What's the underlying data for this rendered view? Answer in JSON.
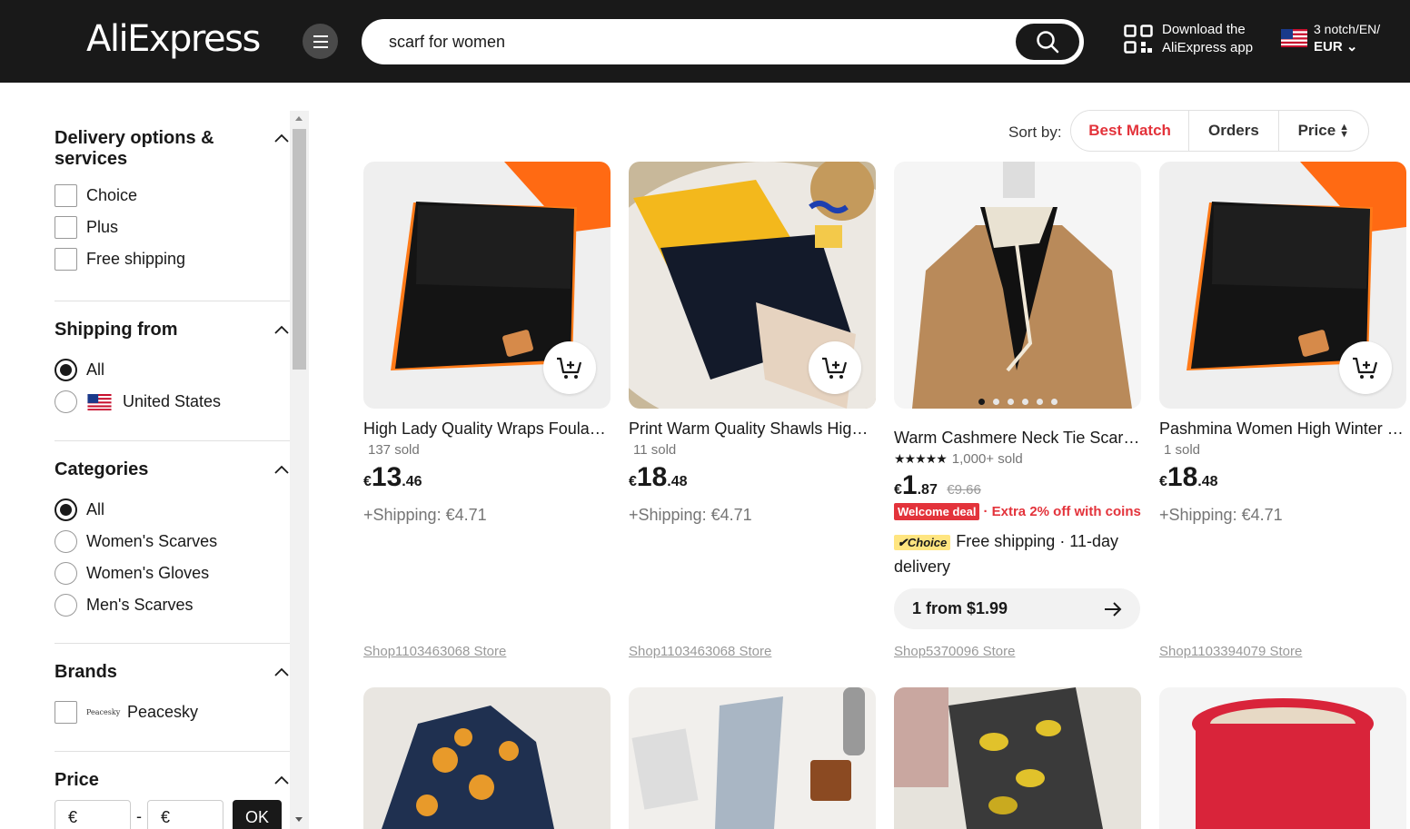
{
  "header": {
    "logo": "AliExpress",
    "search_value": "scarf for women",
    "download_line1": "Download the",
    "download_line2": "AliExpress app",
    "locale_line1": "3 notch/EN/",
    "currency": "EUR"
  },
  "filters": {
    "delivery": {
      "title": "Delivery options & services",
      "options": [
        "Choice",
        "Plus",
        "Free shipping"
      ]
    },
    "shipping_from": {
      "title": "Shipping from",
      "options": [
        "All",
        "United States"
      ],
      "selected": "All"
    },
    "categories": {
      "title": "Categories",
      "options": [
        "All",
        "Women's Scarves",
        "Women's Gloves",
        "Men's Scarves"
      ],
      "selected": "All"
    },
    "brands": {
      "title": "Brands",
      "options": [
        "Peacesky"
      ],
      "logo_text": "Peacesky"
    },
    "price": {
      "title": "Price",
      "min_placeholder": "€",
      "max_placeholder": "€",
      "separator": "-",
      "ok_label": "OK"
    }
  },
  "sort": {
    "label": "Sort by:",
    "options": [
      "Best Match",
      "Orders",
      "Price"
    ],
    "active": "Best Match",
    "active_color": "#e3333b"
  },
  "products": [
    {
      "title": "High Lady Quality Wraps Foulard Winter Scarf",
      "sold": "137 sold",
      "price_currency": "€",
      "price_int": "13",
      "price_dec": ".46",
      "shipping": "+Shipping: €4.71",
      "store": "Shop1103463068 Store"
    },
    {
      "title": "Print Warm Quality Shawls High Quality",
      "sold": "11 sold",
      "price_currency": "€",
      "price_int": "18",
      "price_dec": ".48",
      "shipping": "+Shipping: €4.71",
      "store": "Shop1103463068 Store"
    },
    {
      "title": "Warm Cashmere Neck Tie Scarf for Women",
      "rating_text": "1,000+ sold",
      "price_currency": "€",
      "price_int": "1",
      "price_dec": ".87",
      "original_price": "€9.66",
      "badge": "Welcome deal",
      "extra": "· Extra 2% off with coins",
      "choice_tag": "Choice",
      "delivery": "Free shipping · 11-day delivery",
      "bundle": "1 from $1.99",
      "store": "Shop5370096 Store"
    },
    {
      "title": "Pashmina Women High Winter Scarf",
      "sold": "1 sold",
      "price_currency": "€",
      "price_int": "18",
      "price_dec": ".48",
      "shipping": "+Shipping: €4.71",
      "store": "Shop1103394079 Store"
    }
  ]
}
